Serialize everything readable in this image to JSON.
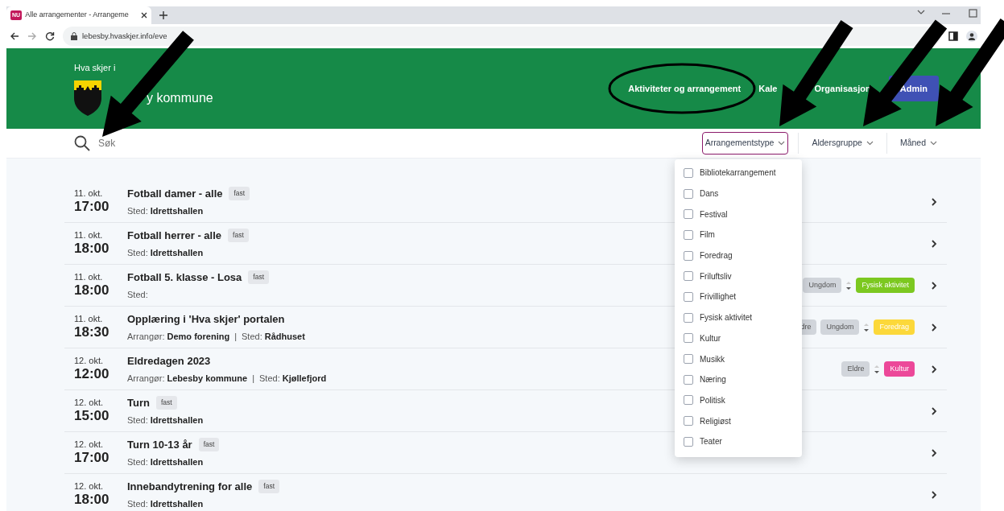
{
  "browser": {
    "tab_favicon": "NU",
    "tab_title": "Alle arrangementer - Arrangeme",
    "address": "lebesby.hvaskjer.info/eve"
  },
  "header": {
    "kicker": "Hva skjer i",
    "site_name": "y kommune",
    "nav": [
      {
        "label": "Aktiviteter og arrangement",
        "kind": "link"
      },
      {
        "label": "Kale",
        "kind": "link"
      },
      {
        "label": "Organisasjon",
        "kind": "link"
      },
      {
        "label": "Admin",
        "kind": "button"
      }
    ]
  },
  "search": {
    "placeholder": "Søk"
  },
  "filters": [
    {
      "label": "Arrangementstype",
      "expanded": true
    },
    {
      "label": "Aldersgruppe",
      "expanded": false
    },
    {
      "label": "Måned",
      "expanded": false
    }
  ],
  "dropdown_options": [
    {
      "label": "Bibliotekarrangement",
      "checked": false
    },
    {
      "label": "Dans",
      "checked": false
    },
    {
      "label": "Festival",
      "checked": false
    },
    {
      "label": "Film",
      "checked": false
    },
    {
      "label": "Foredrag",
      "checked": false
    },
    {
      "label": "Friluftsliv",
      "checked": false
    },
    {
      "label": "Frivillighet",
      "checked": false
    },
    {
      "label": "Fysisk aktivitet",
      "checked": false
    },
    {
      "label": "Kultur",
      "checked": false
    },
    {
      "label": "Musikk",
      "checked": false
    },
    {
      "label": "Næring",
      "checked": false
    },
    {
      "label": "Politisk",
      "checked": false
    },
    {
      "label": "Religiøst",
      "checked": false
    },
    {
      "label": "Teater",
      "checked": false
    }
  ],
  "events": [
    {
      "date": "11. okt.",
      "time": "17:00",
      "title": "Fotball damer - alle",
      "badge": "fast",
      "details": [
        {
          "label": "Sted:",
          "value": "Idrettshallen"
        }
      ]
    },
    {
      "date": "11. okt.",
      "time": "18:00",
      "title": "Fotball herrer - alle",
      "badge": "fast",
      "details": [
        {
          "label": "Sted:",
          "value": "Idrettshallen"
        }
      ]
    },
    {
      "date": "11. okt.",
      "time": "18:00",
      "title": "Fotball 5. klasse - Losa",
      "badge": "fast",
      "details": [
        {
          "label": "Sted:"
        }
      ],
      "tags": [
        {
          "label": "Ungdom",
          "kind": "age",
          "color": "#d1d5db"
        },
        {
          "label": "Fysisk aktivitet",
          "kind": "category",
          "color": "#7cc820"
        }
      ]
    },
    {
      "date": "11. okt.",
      "time": "18:30",
      "title": "Opplæring i 'Hva skjer' portalen",
      "details": [
        {
          "label": "Arrangør:",
          "value": "Demo forening"
        },
        {
          "label": "Sted:",
          "value": "Rådhuset",
          "separator": "|"
        }
      ],
      "tags": [
        {
          "label": "dre",
          "kind": "age",
          "color": "#d1d5db"
        },
        {
          "label": "Ungdom",
          "kind": "age",
          "color": "#d1d5db"
        },
        {
          "label": "Foredrag",
          "kind": "category",
          "color": "#fcd83a"
        }
      ]
    },
    {
      "date": "12. okt.",
      "time": "12:00",
      "title": "Eldredagen 2023",
      "details": [
        {
          "label": "Arrangør:",
          "value": "Lebesby kommune"
        },
        {
          "label": "Sted:",
          "value": "Kjøllefjord",
          "separator": "|"
        }
      ],
      "tags": [
        {
          "label": "Eldre",
          "kind": "age",
          "color": "#d1d5db"
        },
        {
          "label": "Kultur",
          "kind": "category",
          "color": "#ec4899"
        }
      ]
    },
    {
      "date": "12. okt.",
      "time": "15:00",
      "title": "Turn",
      "badge": "fast",
      "details": [
        {
          "label": "Sted:",
          "value": "Idrettshallen"
        }
      ]
    },
    {
      "date": "12. okt.",
      "time": "17:00",
      "title": "Turn 10-13 år",
      "badge": "fast",
      "details": [
        {
          "label": "Sted:",
          "value": "Idrettshallen"
        }
      ]
    },
    {
      "date": "12. okt.",
      "time": "18:00",
      "title": "Innebandytrening for alle",
      "badge": "fast",
      "details": [
        {
          "label": "Sted:",
          "value": "Idrettshallen"
        }
      ]
    }
  ]
}
